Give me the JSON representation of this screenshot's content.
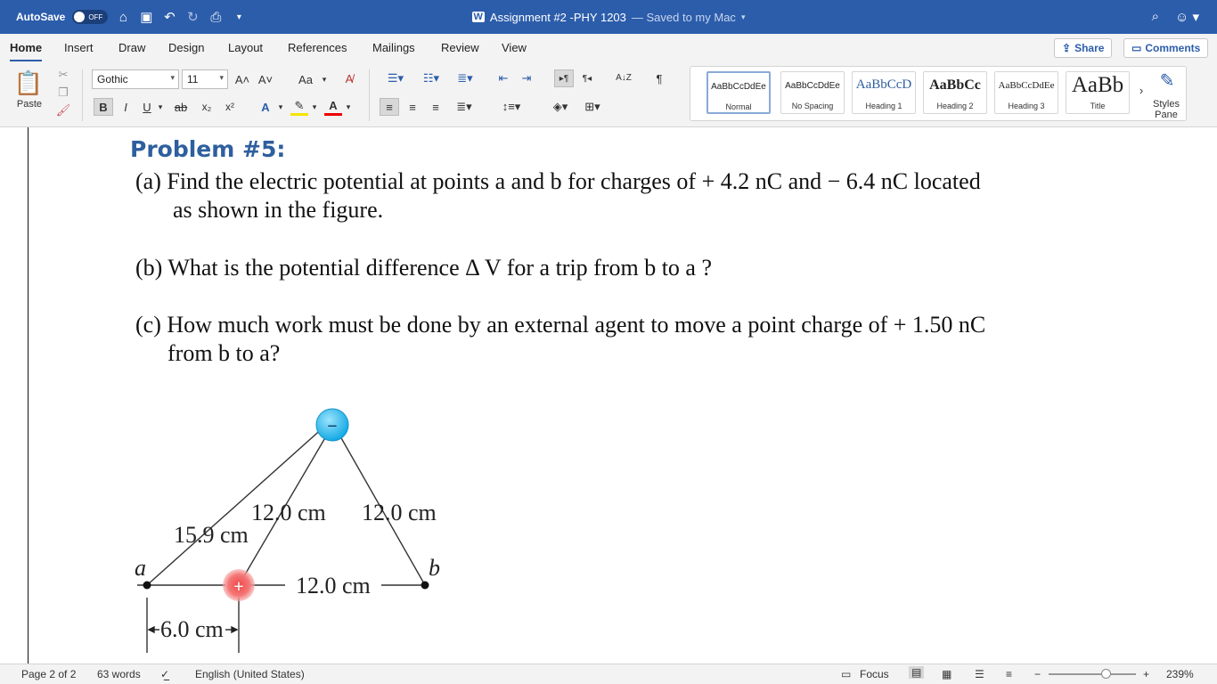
{
  "titlebar": {
    "autosave_label": "AutoSave",
    "autosave_state": "OFF",
    "doc_title": "Assignment #2 -PHY 1203",
    "saved_status": "— Saved to my Mac"
  },
  "tabs": [
    "Home",
    "Insert",
    "Draw",
    "Design",
    "Layout",
    "References",
    "Mailings",
    "Review",
    "View"
  ],
  "share_label": "Share",
  "comments_label": "Comments",
  "ribbon": {
    "paste_label": "Paste",
    "font_name": "Gothic",
    "font_size": "11",
    "aa_label": "Aa",
    "bold": "B",
    "italic": "I",
    "underline": "U",
    "strike": "ab",
    "sub": "x₂",
    "sup": "x²",
    "sort": "A↓Z",
    "pilcrow": "¶",
    "styles": [
      {
        "preview": "AaBbCcDdEe",
        "name": "Normal"
      },
      {
        "preview": "AaBbCcDdEe",
        "name": "No Spacing"
      },
      {
        "preview": "AaBbCcD",
        "name": "Heading 1"
      },
      {
        "preview": "AaBbCc",
        "name": "Heading 2"
      },
      {
        "preview": "AaBbCcDdEe",
        "name": "Heading 3"
      },
      {
        "preview": "AaBb",
        "name": "Title"
      }
    ],
    "styles_pane_line1": "Styles",
    "styles_pane_line2": "Pane"
  },
  "document": {
    "heading": "Problem #5:",
    "a_line1": "(a) Find the electric potential at points a and b for charges of + 4.2 nC and − 6.4 nC located",
    "a_line2": "as shown in the figure.",
    "b_line": "(b) What is the potential difference Δ V for a trip from b to a ?",
    "c_line1": "(c) How much work must be done by an external agent to move a point charge of + 1.50 nC",
    "c_line2": "from b to a?"
  },
  "figure": {
    "label_12_left": "12.0 cm",
    "label_12_right": "12.0 cm",
    "label_159": "15.9 cm",
    "label_12_bottom": "12.0 cm",
    "label_6": "6.0 cm",
    "point_a": "a",
    "point_b": "b",
    "neg_sign": "−",
    "pos_sign": "+"
  },
  "statusbar": {
    "page": "Page 2 of 2",
    "words": "63 words",
    "language": "English (United States)",
    "focus": "Focus",
    "zoom": "239%"
  },
  "colors": {
    "titlebar": "#2c5dab",
    "heading": "#2e5f9e",
    "neg_charge": "#1fb6ef",
    "pos_charge": "#f26d6d"
  }
}
